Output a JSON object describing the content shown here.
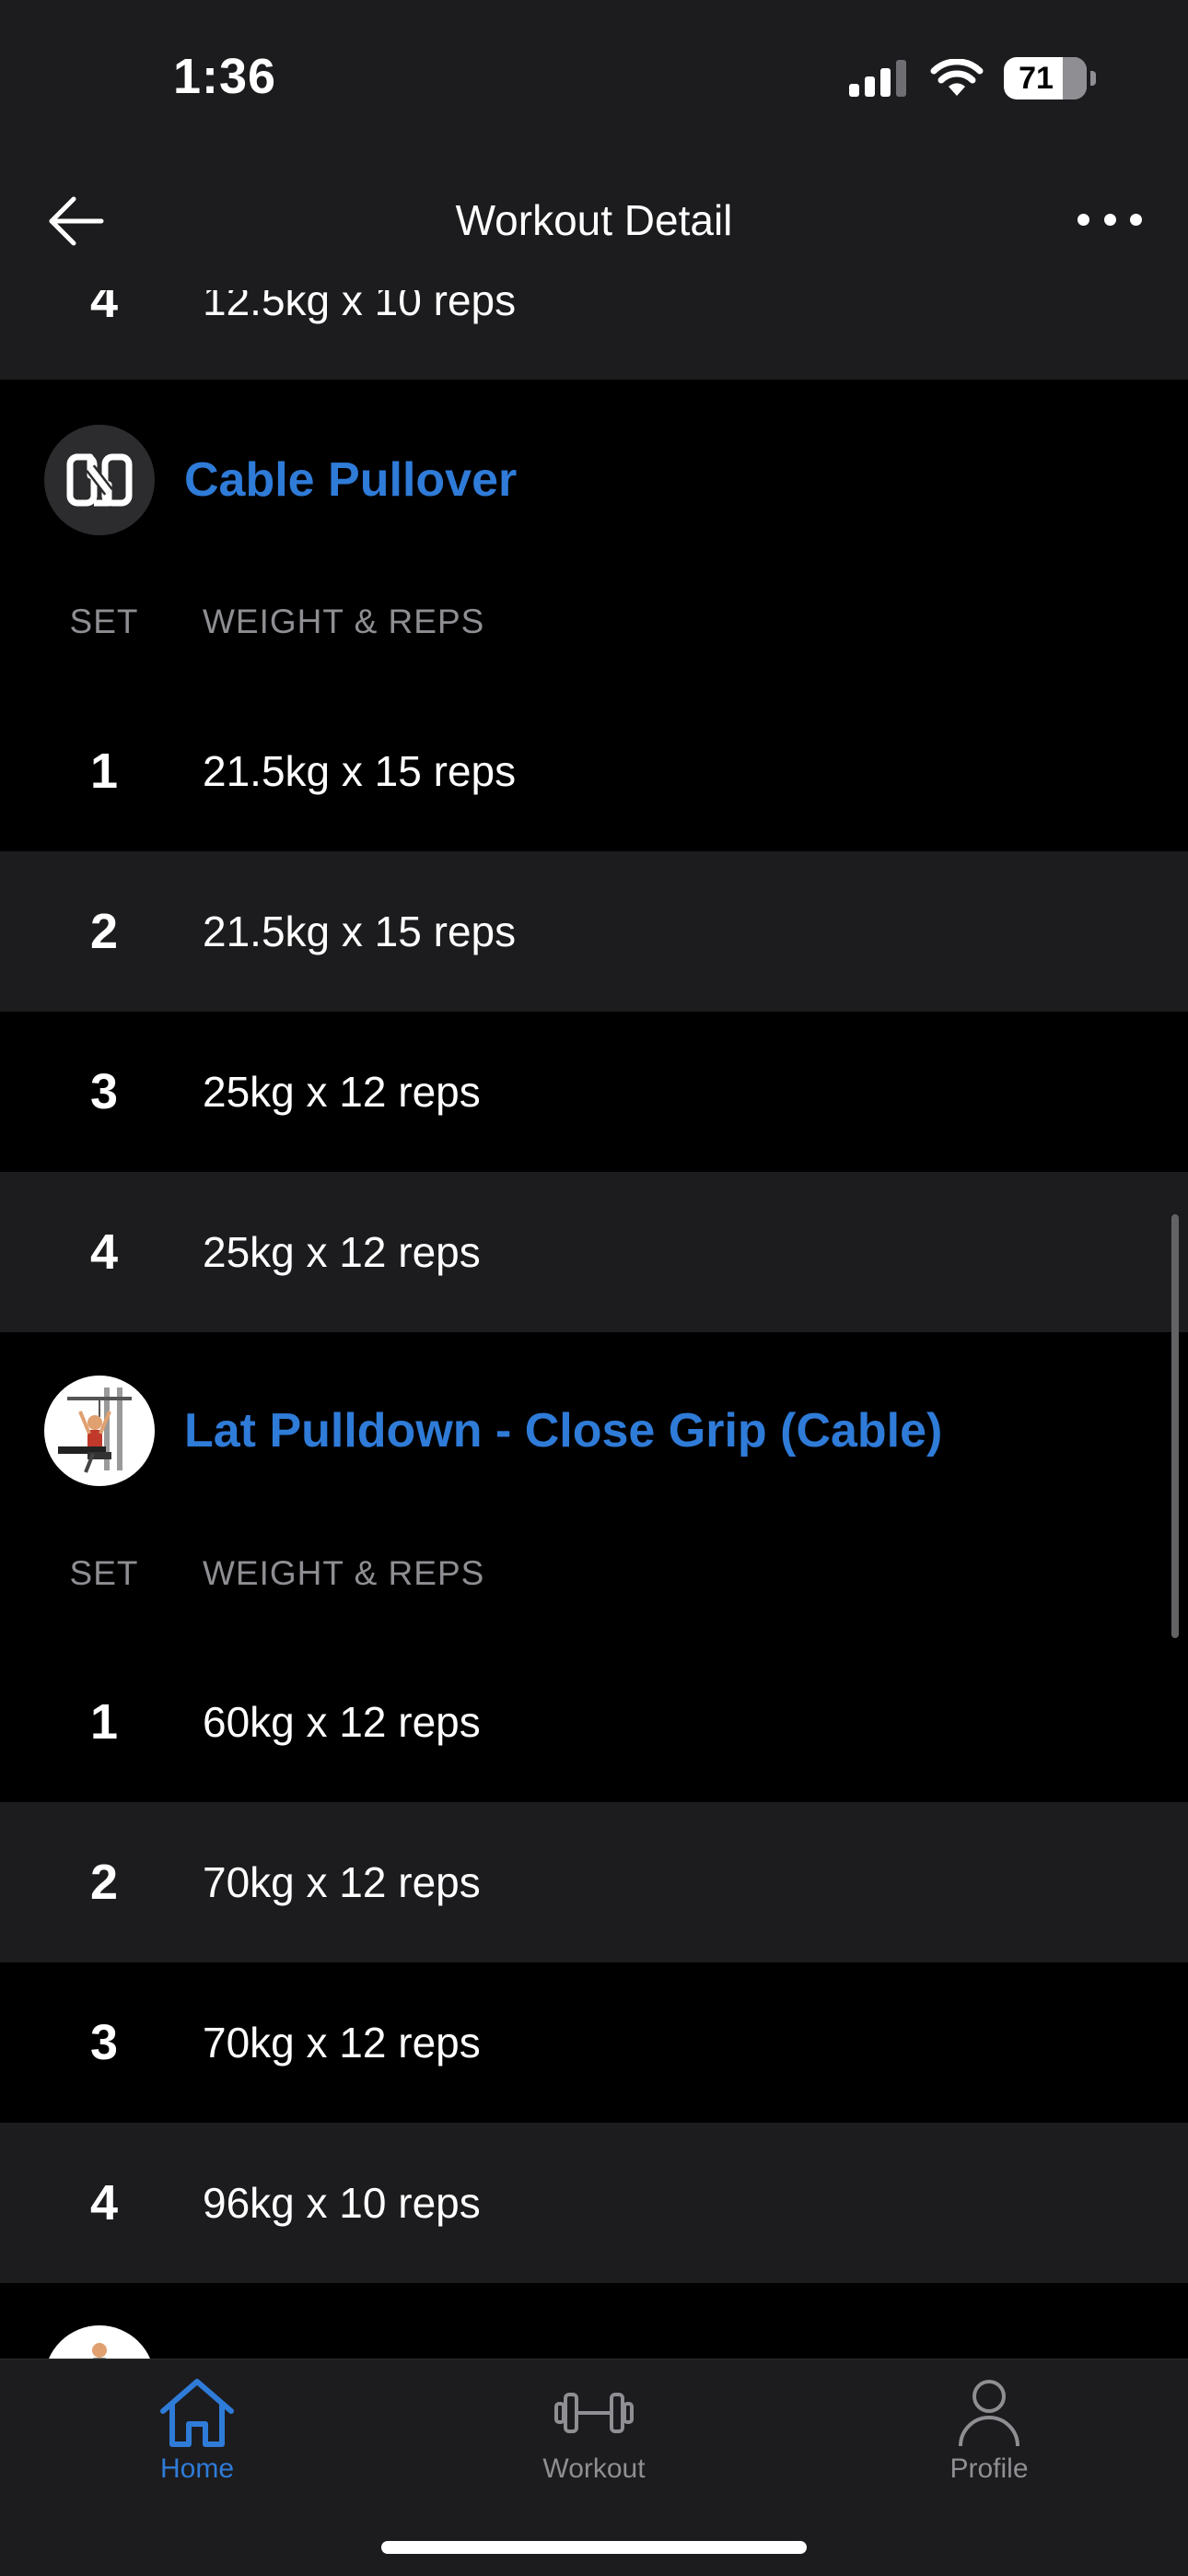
{
  "status_bar": {
    "time": "1:36",
    "battery": "71"
  },
  "nav": {
    "title": "Workout Detail"
  },
  "previous_set": {
    "set": "4",
    "value": "12.5kg x 10 reps"
  },
  "exercises": [
    {
      "name": "Cable Pullover",
      "col_set": "SET",
      "col_weight": "WEIGHT & REPS",
      "sets": [
        {
          "set": "1",
          "value": "21.5kg x 15 reps"
        },
        {
          "set": "2",
          "value": "21.5kg x 15 reps"
        },
        {
          "set": "3",
          "value": "25kg x 12 reps"
        },
        {
          "set": "4",
          "value": "25kg x 12 reps"
        }
      ]
    },
    {
      "name": "Lat Pulldown - Close Grip (Cable)",
      "col_set": "SET",
      "col_weight": "WEIGHT & REPS",
      "sets": [
        {
          "set": "1",
          "value": "60kg x 12 reps"
        },
        {
          "set": "2",
          "value": "70kg x 12 reps"
        },
        {
          "set": "3",
          "value": "70kg x 12 reps"
        },
        {
          "set": "4",
          "value": "96kg x 10 reps"
        }
      ]
    }
  ],
  "tabs": [
    {
      "label": "Home",
      "icon": "home-icon",
      "active": true
    },
    {
      "label": "Workout",
      "icon": "dumbbell-icon",
      "active": false
    },
    {
      "label": "Profile",
      "icon": "person-icon",
      "active": false
    }
  ],
  "colors": {
    "accent": "#2f7bd8",
    "row_light": "#1c1c1e",
    "row_dark": "#000000"
  }
}
